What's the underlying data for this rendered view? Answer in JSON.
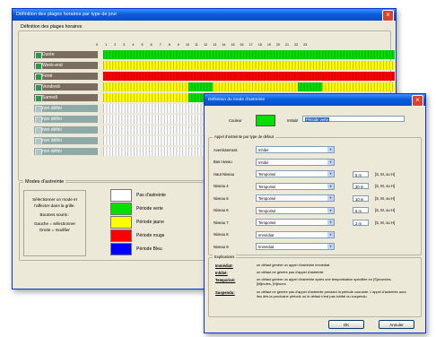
{
  "main_window": {
    "title": "Définition des plages horaires par type de jour",
    "section_label": "Définition des plages horaires",
    "hours": [
      "0",
      "1",
      "2",
      "3",
      "4",
      "5",
      "6",
      "7",
      "8",
      "9",
      "10",
      "11",
      "12",
      "13",
      "14",
      "15",
      "16",
      "17",
      "18",
      "19",
      "20",
      "21",
      "22",
      "23"
    ],
    "days": [
      {
        "label": "Durée",
        "empty": false
      },
      {
        "label": "Week-end",
        "empty": false
      },
      {
        "label": "Férié",
        "empty": false
      },
      {
        "label": "Vendredi",
        "empty": false
      },
      {
        "label": "Samedi",
        "empty": false
      },
      {
        "label": "non défini",
        "empty": true
      },
      {
        "label": "non défini",
        "empty": true
      },
      {
        "label": "non défini",
        "empty": true
      },
      {
        "label": "non défini",
        "empty": true
      },
      {
        "label": "non défini",
        "empty": true
      }
    ],
    "modes_group": "Modes d'astreinte",
    "instructions": [
      "Sélectionner un mode et",
      "l'affecter dans la grille.",
      "Boutons souris :",
      "Gauche = sélectionner",
      "Droite = modifier"
    ],
    "legend": [
      {
        "label": "Pas d'astreinte",
        "color": "#ffffff"
      },
      {
        "label": "Période verte",
        "color": "#00e000"
      },
      {
        "label": "Période jaune",
        "color": "#ffff00"
      },
      {
        "label": "Période rouge",
        "color": "#ff0000"
      },
      {
        "label": "Période Bleu",
        "color": "#0000ff"
      }
    ]
  },
  "dialog": {
    "title": "Définition du mode d'astreinte",
    "couleur_label": "Couleur",
    "couleur_value": "#00e000",
    "intitule_label": "Intitulé",
    "intitule_value": "Période verte",
    "group_label": "Appel d'astreinte par type de défaut",
    "rows": [
      {
        "label": "Avertissement",
        "value": "Inhibé",
        "delay": "",
        "unit": ""
      },
      {
        "label": "Bas niveau",
        "value": "Inhibé",
        "delay": "",
        "unit": ""
      },
      {
        "label": "Haut Niveau",
        "value": "Temporisé",
        "delay": "5 m",
        "unit": "[S, M, ou H]"
      },
      {
        "label": "Niveau 4",
        "value": "Temporisé",
        "delay": "30 m",
        "unit": "[S, M, ou H]"
      },
      {
        "label": "Niveau 5",
        "value": "Temporisé",
        "delay": "10 m",
        "unit": "[S, M, ou H]"
      },
      {
        "label": "Niveau 6",
        "value": "Temporisé",
        "delay": "5 m",
        "unit": "[S, M, ou H]"
      },
      {
        "label": "Niveau 7",
        "value": "Temporisé",
        "delay": "2 m",
        "unit": "[S, M, ou H]"
      },
      {
        "label": "Niveau 8",
        "value": "Immédiat",
        "delay": "",
        "unit": ""
      },
      {
        "label": "Niveau 9",
        "value": "Immédiat",
        "delay": "",
        "unit": ""
      }
    ],
    "explain_group": "Explications",
    "explanations": [
      {
        "term": "Immédiat:",
        "text": "un défaut génère un appel d'astreinte immédiat"
      },
      {
        "term": "Inhibé:",
        "text": "un défaut ne génère pas d'appel d'astreinte"
      },
      {
        "term": "Temporisé:",
        "text": "un défaut génère un appel d'astreinte après une temporisation spécifiée en [S]econdes, [M]inutes, [H]eures"
      },
      {
        "term": "Suspendu:",
        "text": "un défaut ne génère pas d'appel d'astreinte pendant la période courante. L'appel d'astreinte aura lieu dès la prochaine période où le défaut n'est pas inhibé ou suspendu"
      }
    ],
    "ok_label": "OK",
    "cancel_label": "Annuler"
  }
}
